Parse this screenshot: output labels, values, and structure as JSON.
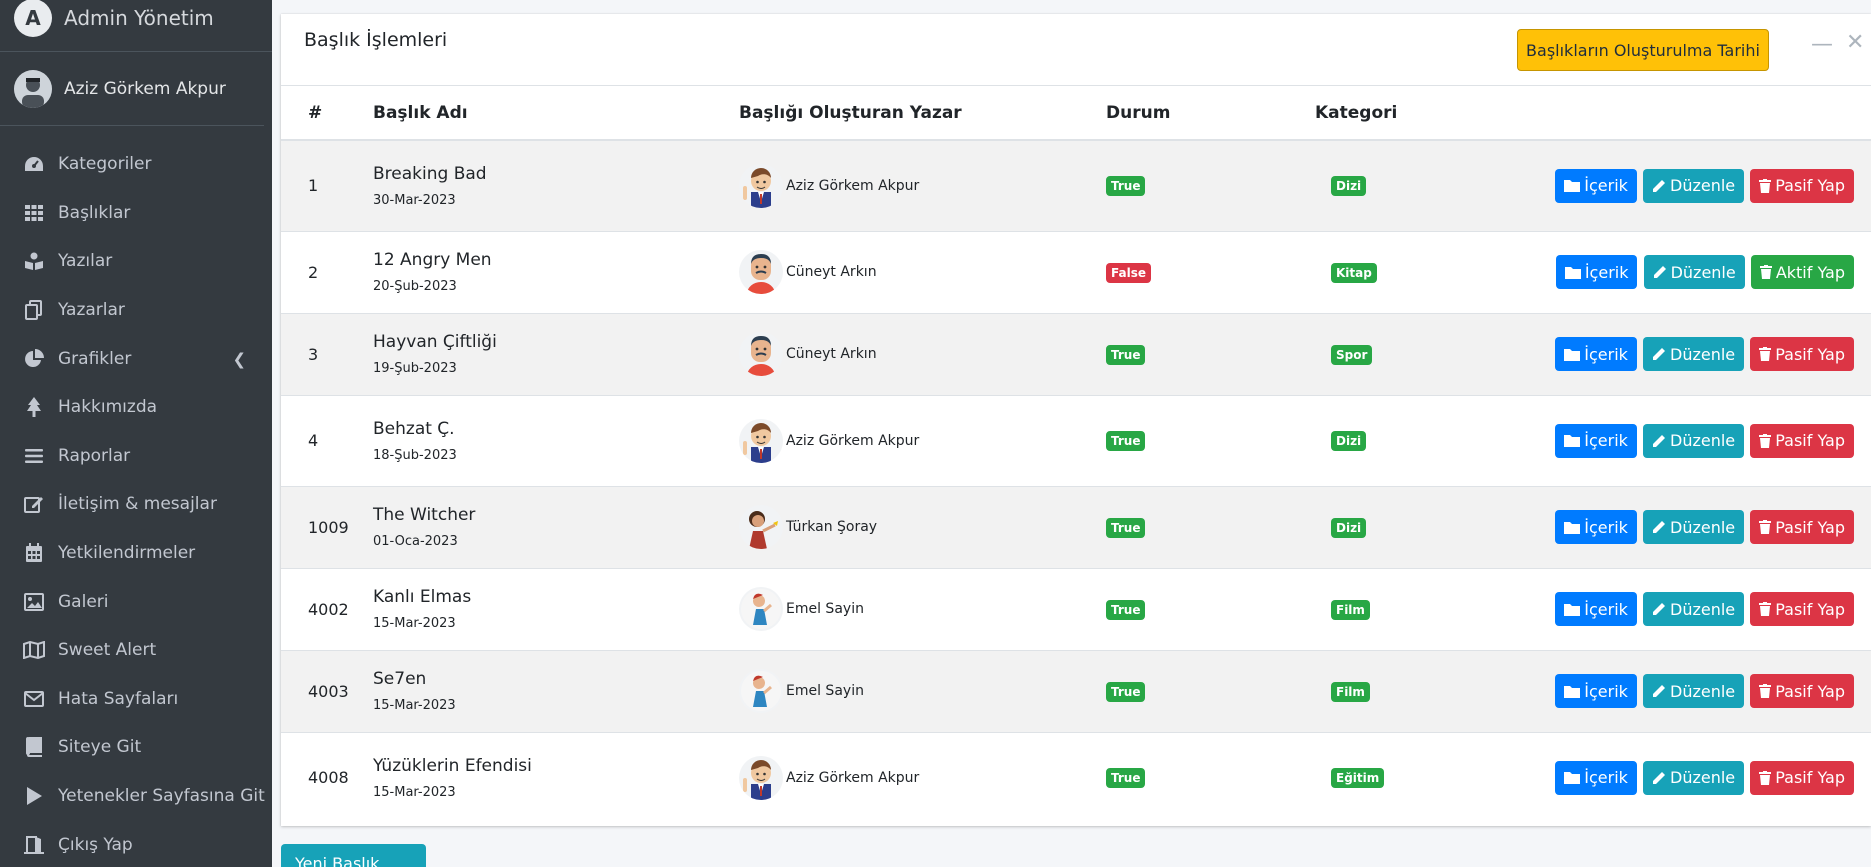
{
  "app": {
    "title": "Admin Yönetim"
  },
  "user": {
    "name": "Aziz Görkem Akpur"
  },
  "sidebar": {
    "items": [
      {
        "label": "Kategoriler",
        "icon": "dashboard-icon"
      },
      {
        "label": "Başlıklar",
        "icon": "grid-icon"
      },
      {
        "label": "Yazılar",
        "icon": "book-reader-icon"
      },
      {
        "label": "Yazarlar",
        "icon": "copy-icon"
      },
      {
        "label": "Grafikler",
        "icon": "pie-chart-icon"
      },
      {
        "label": "Hakkımızda",
        "icon": "tree-icon"
      },
      {
        "label": "Raporlar",
        "icon": "bars-icon"
      },
      {
        "label": "İletişim & mesajlar",
        "icon": "edit-icon"
      },
      {
        "label": "Yetkilendirmeler",
        "icon": "calendar-icon"
      },
      {
        "label": "Galeri",
        "icon": "image-icon"
      },
      {
        "label": "Sweet Alert",
        "icon": "map-icon"
      },
      {
        "label": "Hata Sayfaları",
        "icon": "envelope-icon"
      },
      {
        "label": "Siteye Git",
        "icon": "book-icon"
      },
      {
        "label": "Yetenekler Sayfasına Git",
        "icon": "play-icon"
      },
      {
        "label": "Çıkış Yap",
        "icon": "door-open-icon"
      }
    ]
  },
  "card": {
    "title": "Başlık İşlemleri",
    "date_button": "Başlıkların Oluşturulma Tarihi"
  },
  "table": {
    "headers": {
      "id": "#",
      "title": "Başlık Adı",
      "author": "Başlığı Oluşturan Yazar",
      "status": "Durum",
      "category": "Kategori"
    },
    "buttons": {
      "content": "İçerik",
      "edit": "Düzenle",
      "deactivate": "Pasif Yap",
      "activate": "Aktif Yap"
    },
    "rows": [
      {
        "id": "1",
        "title": "Breaking Bad",
        "date": "30-Mar-2023",
        "author": "Aziz Görkem Akpur",
        "status": "True",
        "category": "Dizi",
        "action": "Pasif Yap"
      },
      {
        "id": "2",
        "title": "12 Angry Men",
        "date": "20-Şub-2023",
        "author": "Cüneyt Arkın",
        "status": "False",
        "category": "Kitap",
        "action": "Aktif Yap"
      },
      {
        "id": "3",
        "title": "Hayvan Çiftliği",
        "date": "19-Şub-2023",
        "author": "Cüneyt Arkın",
        "status": "True",
        "category": "Spor",
        "action": "Pasif Yap"
      },
      {
        "id": "4",
        "title": "Behzat Ç.",
        "date": "18-Şub-2023",
        "author": "Aziz Görkem Akpur",
        "status": "True",
        "category": "Dizi",
        "action": "Pasif Yap"
      },
      {
        "id": "1009",
        "title": "The Witcher",
        "date": "01-Oca-2023",
        "author": "Türkan Şoray",
        "status": "True",
        "category": "Dizi",
        "action": "Pasif Yap"
      },
      {
        "id": "4002",
        "title": "Kanlı Elmas",
        "date": "15-Mar-2023",
        "author": "Emel Sayin",
        "status": "True",
        "category": "Film",
        "action": "Pasif Yap"
      },
      {
        "id": "4003",
        "title": "Se7en",
        "date": "15-Mar-2023",
        "author": "Emel Sayin",
        "status": "True",
        "category": "Film",
        "action": "Pasif Yap"
      },
      {
        "id": "4008",
        "title": "Yüzüklerin Efendisi",
        "date": "15-Mar-2023",
        "author": "Aziz Görkem Akpur",
        "status": "True",
        "category": "Eğitim",
        "action": "Pasif Yap"
      }
    ]
  },
  "add_button": "Yeni Başlık Ekle",
  "colors": {
    "sidebar": "#343a40",
    "primary": "#007bff",
    "info": "#17a2b8",
    "danger": "#dc3545",
    "success": "#28a745",
    "warning": "#ffc107"
  }
}
